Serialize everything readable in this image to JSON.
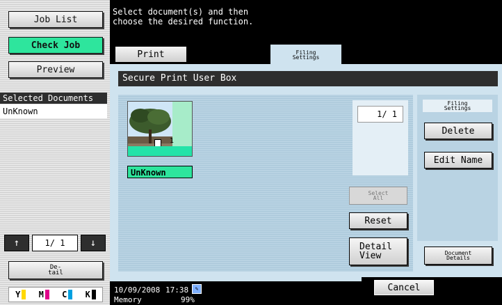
{
  "left_panel": {
    "job_list": "Job List",
    "check_job": "Check Job",
    "preview": "Preview",
    "selected_title": "Selected Documents",
    "selected_items": [
      "UnKnown"
    ],
    "pager": {
      "up_icon": "arrow-up-icon",
      "down_icon": "arrow-down-icon",
      "value": "1/ 1"
    },
    "detail": "De-\ntail",
    "toner": [
      {
        "label": "Y",
        "color": "#ffd800"
      },
      {
        "label": "M",
        "color": "#e0008a"
      },
      {
        "label": "C",
        "color": "#00a0e0"
      },
      {
        "label": "K",
        "color": "#000000"
      }
    ]
  },
  "message": "Select document(s) and then\nchoose the desired function.",
  "tabs": {
    "print": "Print",
    "filing_settings": "Filing\nSettings"
  },
  "box_title": "Secure Print User Box",
  "document": {
    "name": "UnKnown",
    "copies": "1"
  },
  "counter": "1/  1",
  "actions": {
    "select_all": "Select\nAll",
    "reset": "Reset",
    "detail_view": "Detail\nView"
  },
  "right_panel": {
    "header": "Filing\nSettings",
    "delete": "Delete",
    "edit_name": "Edit Name",
    "document_details": "Document\nDetails"
  },
  "status": {
    "date": "10/09/2008",
    "time": "17:38",
    "memory_label": "Memory",
    "memory_value": "99%"
  },
  "cancel": "Cancel"
}
